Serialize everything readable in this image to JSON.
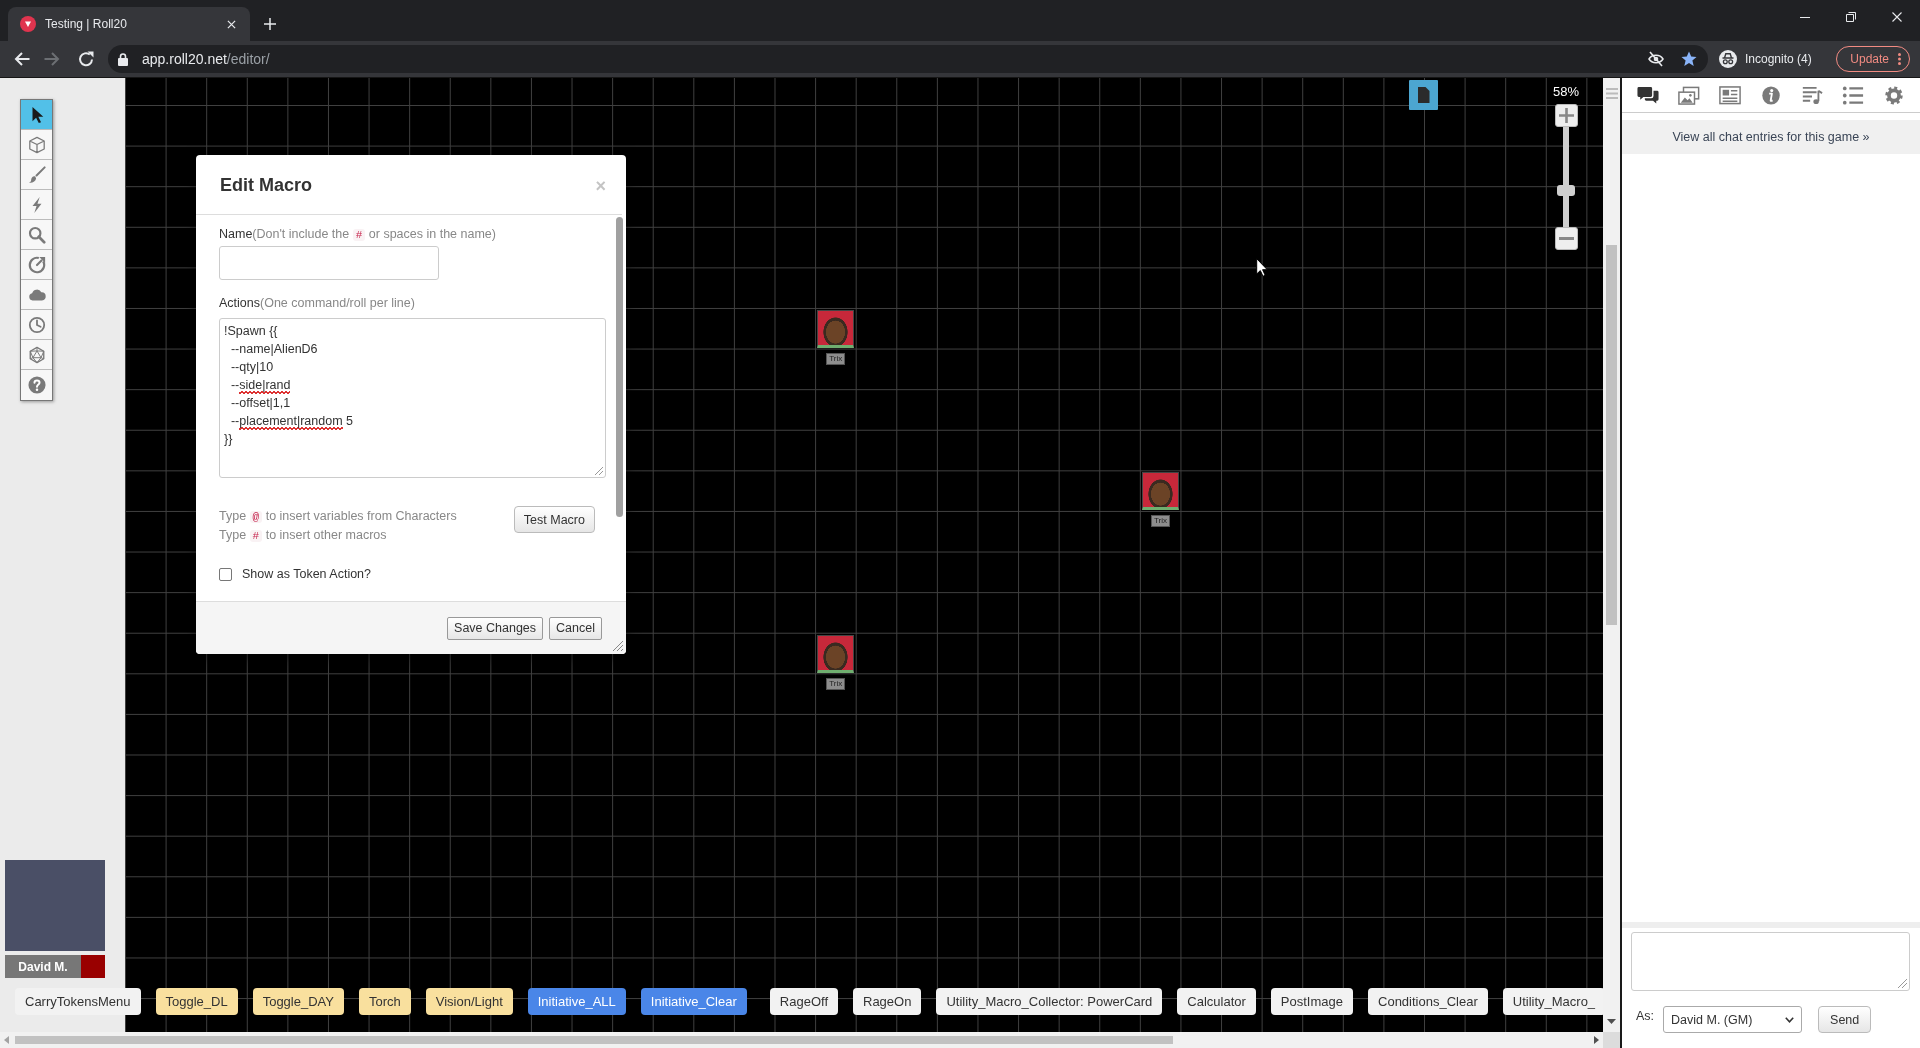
{
  "browser": {
    "tab": {
      "title": "Testing | Roll20"
    },
    "address": {
      "host": "app.roll20.net",
      "path": "/editor/"
    },
    "profile": "Incognito (4)",
    "update": "Update"
  },
  "toolbox": {
    "tools": [
      {
        "selected": true
      },
      {
        "selected": false
      },
      {
        "selected": false
      },
      {
        "selected": false
      },
      {
        "selected": false
      },
      {
        "selected": false
      },
      {
        "selected": false
      },
      {
        "selected": false
      },
      {
        "selected": false
      },
      {
        "selected": false
      }
    ]
  },
  "dialog": {
    "title": "Edit Macro",
    "close": "×",
    "name_label": [
      {
        "kind": "label",
        "text": "Name"
      },
      {
        "kind": "hint",
        "text": "(Don't include the "
      },
      {
        "kind": "code",
        "text": "#"
      },
      {
        "kind": "hint",
        "text": " or spaces in the name)"
      }
    ],
    "actions_label": [
      {
        "kind": "label",
        "text": "Actions"
      },
      {
        "kind": "hint",
        "text": "(One command/roll per line)"
      }
    ],
    "actions_lines": [
      {
        "parts": [
          {
            "text": "!Spawn {{",
            "misspelled": false
          }
        ]
      },
      {
        "parts": [
          {
            "text": "  --name|AlienD6",
            "misspelled": false
          }
        ]
      },
      {
        "parts": [
          {
            "text": "  --qty|10",
            "misspelled": false
          }
        ]
      },
      {
        "parts": [
          {
            "text": "  --",
            "misspelled": false
          },
          {
            "text": "side|rand",
            "misspelled": true
          }
        ]
      },
      {
        "parts": [
          {
            "text": "  --offset|1,1",
            "misspelled": false
          }
        ]
      },
      {
        "parts": [
          {
            "text": "  --",
            "misspelled": false
          },
          {
            "text": "placement|random",
            "misspelled": true
          },
          {
            "text": " 5",
            "misspelled": false
          }
        ]
      },
      {
        "parts": [
          {
            "text": "}}",
            "misspelled": false
          }
        ]
      }
    ],
    "hints": [
      {
        "parts": [
          {
            "kind": "hint",
            "text": "Type "
          },
          {
            "kind": "code",
            "text": "@"
          },
          {
            "kind": "hint",
            "text": " to insert variables from Characters"
          }
        ]
      },
      {
        "parts": [
          {
            "kind": "hint",
            "text": "Type "
          },
          {
            "kind": "code",
            "text": "#"
          },
          {
            "kind": "hint",
            "text": " to insert other macros"
          }
        ]
      }
    ],
    "test_button": "Test Macro",
    "token_action": {
      "label": "Show as Token Action?",
      "checked": false
    },
    "buttons": [
      "Save Changes",
      "Cancel"
    ]
  },
  "canvas": {
    "zoom": "58%",
    "zoom_slider": {
      "level": 0.35
    },
    "tokens": [
      {
        "name": "Trix"
      },
      {
        "name": "Trix"
      },
      {
        "name": "Trix"
      }
    ]
  },
  "players": [
    {
      "name": "David M.",
      "color": "#990000"
    }
  ],
  "macros": [
    {
      "label": "CarryTokensMenu",
      "color": "#f2f2f2"
    },
    {
      "label": "Toggle_DL",
      "color": "#f9e09e"
    },
    {
      "label": "Toggle_DAY",
      "color": "#f9e09e"
    },
    {
      "label": "Torch",
      "color": "#f9e09e"
    },
    {
      "label": "Vision/Light",
      "color": "#f9e09e"
    },
    {
      "label": "Initiative_ALL",
      "color": "#4a86e8"
    },
    {
      "label": "Initiative_Clear",
      "color": "#4a86e8"
    },
    {
      "label": "RageOff",
      "color": "#f2f2f2"
    },
    {
      "label": "RageOn",
      "color": "#f2f2f2"
    },
    {
      "label": "Utility_Macro_Collector: PowerCard",
      "color": "#f2f2f2"
    },
    {
      "label": "Calculator",
      "color": "#f2f2f2"
    },
    {
      "label": "PostImage",
      "color": "#f2f2f2"
    },
    {
      "label": "Conditions_Clear",
      "color": "#f2f2f2"
    },
    {
      "label": "Utility_Macro_",
      "color": "#f2f2f2"
    }
  ],
  "chat": {
    "tabs": [
      {
        "selected": true
      },
      {
        "selected": false
      },
      {
        "selected": false
      },
      {
        "selected": false
      },
      {
        "selected": false
      },
      {
        "selected": false
      },
      {
        "selected": false
      }
    ],
    "history_link": "View all chat entries for this game »",
    "as_label": "As:",
    "speaking_as": "David M. (GM)",
    "send": "Send"
  }
}
